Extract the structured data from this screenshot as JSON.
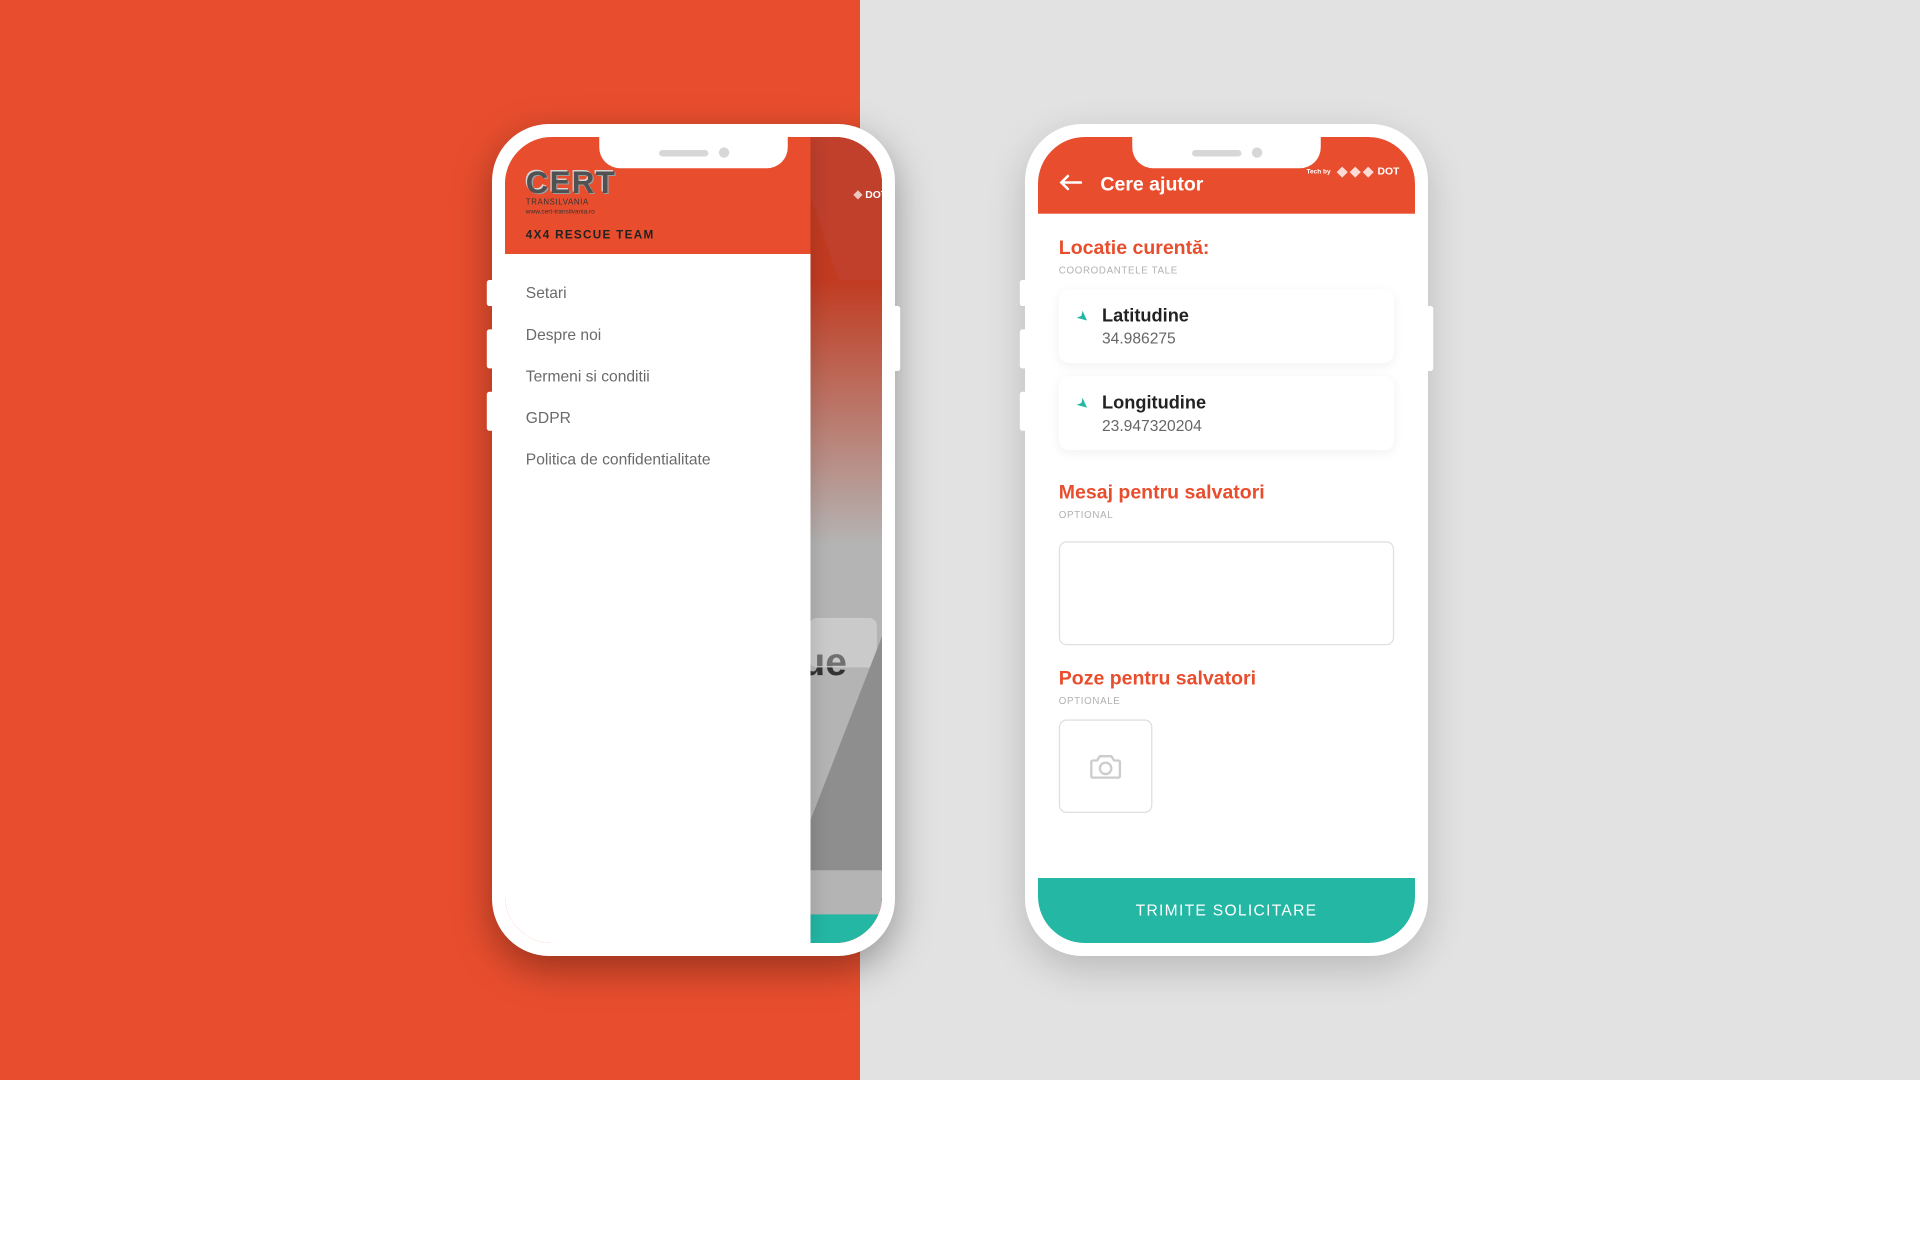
{
  "left": {
    "logo_main": "CERT",
    "logo_sub": "TRANSILVANIA",
    "logo_url": "www.cert-transilvania.ro",
    "rescue": "4X4 RESCUE TEAM",
    "bg_text": "ue",
    "dot_brand": "DOT",
    "menu": [
      "Setari",
      "Despre noi",
      "Termeni si conditii",
      "GDPR",
      "Politica de confidentialitate"
    ]
  },
  "right": {
    "title": "Cere ajutor",
    "tech_by": "Tech by",
    "dot_brand": "DOT",
    "loc_title": "Locatie curentă:",
    "loc_sub": "COORODANTELE TALE",
    "lat_label": "Latitudine",
    "lat_value": "34.986275",
    "lon_label": "Longitudine",
    "lon_value": "23.947320204",
    "msg_title": "Mesaj pentru salvatori",
    "msg_sub": "OPTIONAL",
    "photo_title": "Poze pentru salvatori",
    "photo_sub": "OPTIONALE",
    "submit": "TRIMITE SOLICITARE"
  },
  "colors": {
    "accent": "#e84e2e",
    "teal": "#24b7a4"
  }
}
